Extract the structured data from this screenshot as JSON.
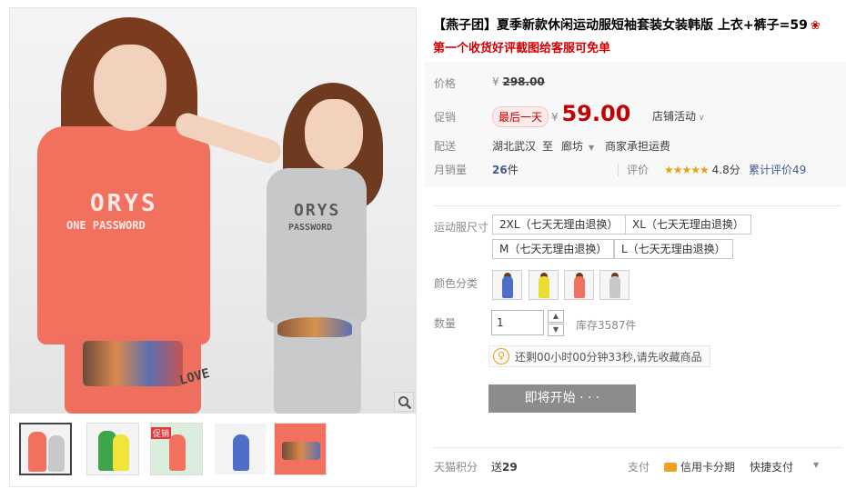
{
  "product": {
    "title": "【燕子团】夏季新款休闲运动服短袖套装女装韩版 上衣+裤子=59",
    "subtitle": "第一个收货好评截图给客服可免单",
    "shirt_text_1": "ORYS",
    "shirt_text_2": "ONE PASSWORD",
    "shirt_text_3": "ORYS",
    "shirt_text_4": "PASSWORD",
    "pants_text": "LOVE"
  },
  "gallery": {
    "thumb_tag": "促销"
  },
  "price": {
    "label": "价格",
    "currency": "¥",
    "original": "298.00"
  },
  "promo": {
    "label": "促销",
    "tag": "最后一天",
    "currency": "¥",
    "price": "59.00",
    "shop_activity": "店铺活动"
  },
  "delivery": {
    "label": "配送",
    "from": "湖北武汉",
    "to_word": "至",
    "to": "廊坊",
    "fee": "商家承担运费"
  },
  "sales": {
    "label": "月销量",
    "count": "26",
    "unit": "件",
    "rating_label": "评价",
    "stars": "★★★★★",
    "score": "4.8分",
    "total_reviews": "累计评价49"
  },
  "size": {
    "label": "运动服尺寸",
    "options": [
      "2XL（七天无理由退换）",
      "XL（七天无理由退换）",
      "M（七天无理由退换）",
      "L（七天无理由退换）"
    ]
  },
  "color": {
    "label": "颜色分类"
  },
  "quantity": {
    "label": "数量",
    "value": "1",
    "stock": "库存3587件"
  },
  "tip": {
    "text": "还剩00小时00分钟33秒,请先收藏商品"
  },
  "action": {
    "start_label": "即将开始 · · ·"
  },
  "footer": {
    "points_label": "天猫积分",
    "points_prefix": "送",
    "points_value": "29",
    "pay_label": "支付",
    "credit_card": "信用卡分期",
    "quick_pay": "快捷支付"
  },
  "colors": {
    "accent": "#c40000",
    "link": "#3e5b8e",
    "button": "#8c8c8c"
  }
}
